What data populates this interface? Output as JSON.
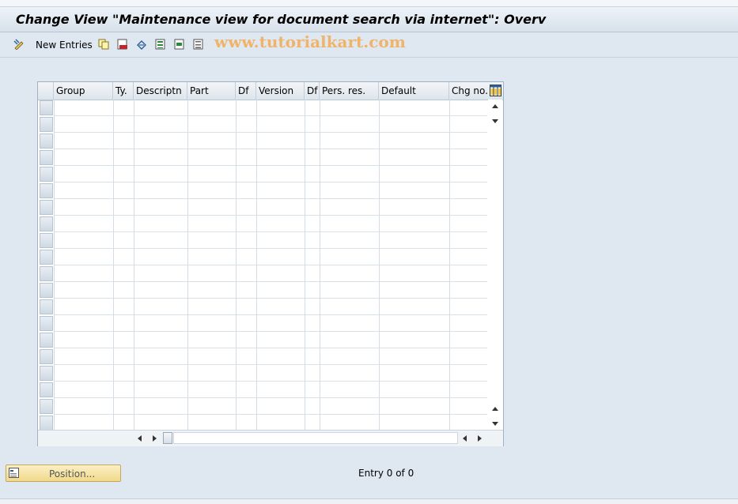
{
  "window": {
    "title": "Change View \"Maintenance view for document search via internet\": Overv"
  },
  "toolbar": {
    "new_entries_label": "New Entries",
    "watermark": "www.tutorialkart.com"
  },
  "table": {
    "columns": [
      "Group",
      "Ty.",
      "Descriptn",
      "Part",
      "Df",
      "Version",
      "Df",
      "Pers. res.",
      "Default",
      "Chg no."
    ],
    "row_count": 20
  },
  "footer": {
    "position_label": "Position...",
    "entry_text": "Entry 0 of 0"
  }
}
